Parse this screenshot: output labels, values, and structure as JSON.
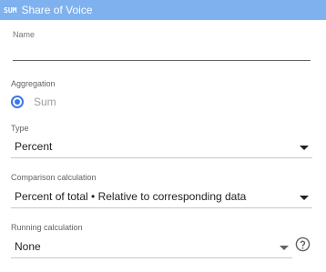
{
  "header": {
    "badge": "SUM",
    "title": "Share of Voice"
  },
  "name": {
    "label": "Name",
    "value": ""
  },
  "aggregation": {
    "label": "Aggregation",
    "option": "Sum"
  },
  "type": {
    "label": "Type",
    "value": "Percent"
  },
  "comparison": {
    "label": "Comparison calculation",
    "value": "Percent of total • Relative to corresponding data"
  },
  "running": {
    "label": "Running calculation",
    "value": "None",
    "help_icon": "help-circle-icon"
  },
  "colors": {
    "header_bg": "#7fb1ee",
    "accent": "#3b78e7"
  }
}
